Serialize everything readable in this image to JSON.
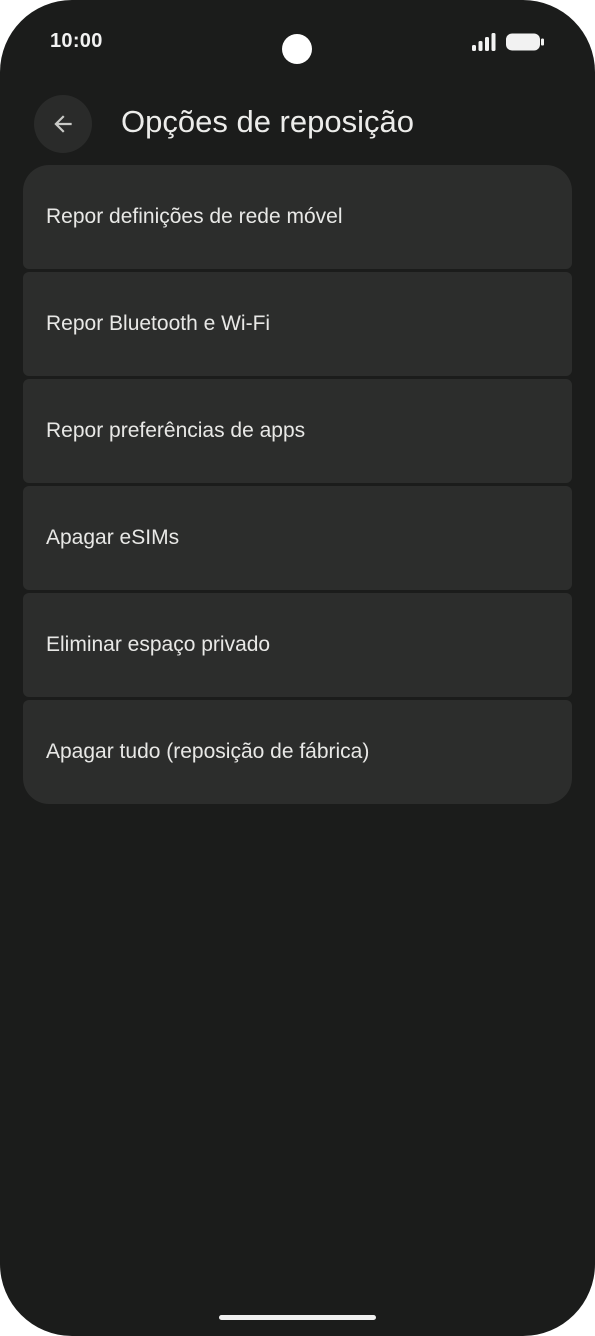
{
  "status_bar": {
    "time": "10:00",
    "icons": [
      "signal-icon",
      "battery-icon"
    ]
  },
  "header": {
    "back_icon": "arrow-left-icon",
    "title": "Opções de reposição"
  },
  "settings": {
    "items": [
      {
        "label": "Repor definições de rede móvel"
      },
      {
        "label": "Repor Bluetooth e Wi-Fi"
      },
      {
        "label": "Repor preferências de apps"
      },
      {
        "label": "Apagar eSIMs"
      },
      {
        "label": "Eliminar espaço privado"
      },
      {
        "label": "Apagar tudo (reposição de fábrica)"
      }
    ]
  },
  "colors": {
    "background": "#1b1c1b",
    "card": "#2c2d2c",
    "text": "#e8e8e6",
    "back_button": "#2a2b2a"
  }
}
